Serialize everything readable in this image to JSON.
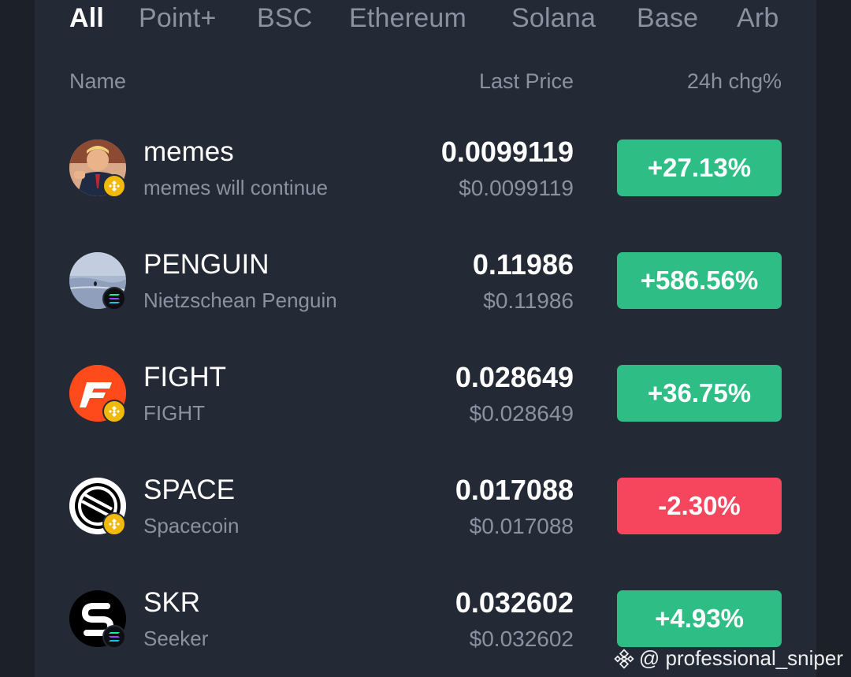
{
  "tabs": [
    "All",
    "Point+",
    "BSC",
    "Ethereum",
    "Solana",
    "Base",
    "Arb"
  ],
  "columns": {
    "name": "Name",
    "price": "Last Price",
    "change": "24h chg%"
  },
  "colors": {
    "up": "#2ebd85",
    "down": "#f6465d",
    "bnb": "#f0b90b",
    "panel": "#242a35"
  },
  "rows": [
    {
      "symbol": "memes",
      "name": "memes will continue",
      "price": "0.0099119",
      "usd": "$0.0099119",
      "change": "+27.13%",
      "direction": "up",
      "chain": "bnb",
      "icon": "memes-avatar-icon"
    },
    {
      "symbol": "PENGUIN",
      "name": "Nietzschean Penguin",
      "price": "0.11986",
      "usd": "$0.11986",
      "change": "+586.56%",
      "direction": "up",
      "chain": "sol",
      "icon": "penguin-avatar-icon"
    },
    {
      "symbol": "FIGHT",
      "name": "FIGHT",
      "price": "0.028649",
      "usd": "$0.028649",
      "change": "+36.75%",
      "direction": "up",
      "chain": "bnb",
      "icon": "fight-logo-icon"
    },
    {
      "symbol": "SPACE",
      "name": "Spacecoin",
      "price": "0.017088",
      "usd": "$0.017088",
      "change": "-2.30%",
      "direction": "down",
      "chain": "bnb",
      "icon": "spacecoin-logo-icon"
    },
    {
      "symbol": "SKR",
      "name": "Seeker",
      "price": "0.032602",
      "usd": "$0.032602",
      "change": "+4.93%",
      "direction": "up",
      "chain": "sol",
      "icon": "seeker-logo-icon"
    }
  ],
  "watermark": "@ professional_sniper"
}
